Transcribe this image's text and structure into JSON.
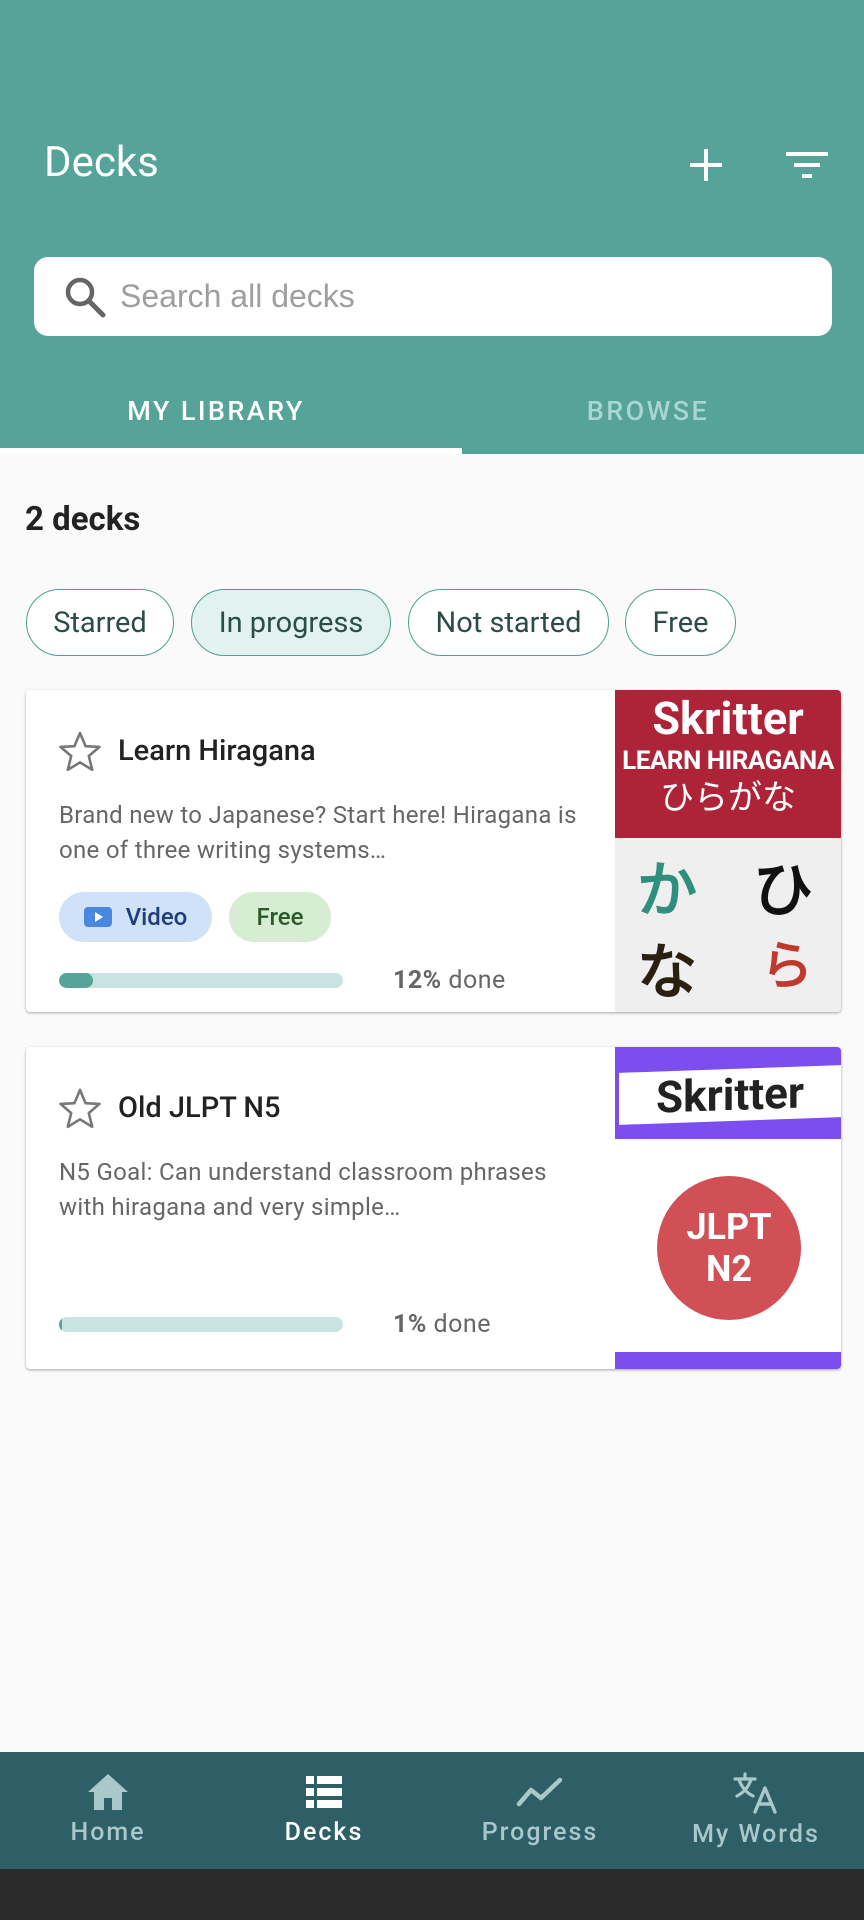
{
  "header": {
    "title": "Decks",
    "add_icon": "plus-icon",
    "filter_icon": "filter-icon"
  },
  "search": {
    "placeholder": "Search all decks"
  },
  "tabs": [
    {
      "label": "MY LIBRARY",
      "active": true
    },
    {
      "label": "BROWSE",
      "active": false
    }
  ],
  "deck_count": "2 decks",
  "filters": [
    {
      "label": "Starred",
      "active": false
    },
    {
      "label": "In progress",
      "active": true
    },
    {
      "label": "Not started",
      "active": false
    },
    {
      "label": "Free",
      "active": false
    }
  ],
  "decks": [
    {
      "title": "Learn Hiragana",
      "description": "Brand new to Japanese? Start here! Hiragana is one of three writing systems…",
      "tags": {
        "video": "Video",
        "free": "Free"
      },
      "progress_pct": "12%",
      "progress_suffix": " done",
      "progress_value": 0.12,
      "thumbnail": {
        "brand": "Skritter",
        "subtitle": "LEARN HIRAGANA",
        "kana": "ひらがな",
        "chars": [
          "か",
          "ひ",
          "な",
          "ら"
        ]
      }
    },
    {
      "title": "Old JLPT N5",
      "description": "N5 Goal: Can understand classroom phrases with hiragana and very simple…",
      "progress_pct": "1%",
      "progress_suffix": " done",
      "progress_value": 0.01,
      "thumbnail": {
        "brand": "Skritter",
        "badge_line1": "JLPT",
        "badge_line2": "N2"
      }
    }
  ],
  "bottom_nav": [
    {
      "label": "Home",
      "icon": "home-icon",
      "active": false
    },
    {
      "label": "Decks",
      "icon": "decks-icon",
      "active": true
    },
    {
      "label": "Progress",
      "icon": "progress-icon",
      "active": false
    },
    {
      "label": "My Words",
      "icon": "translate-icon",
      "active": false
    }
  ],
  "colors": {
    "primary": "#55a399",
    "nav_bg": "#2f5f66",
    "thumb_red": "#ad2337",
    "thumb_purple": "#7c4ef0",
    "badge_red": "#d05056"
  }
}
